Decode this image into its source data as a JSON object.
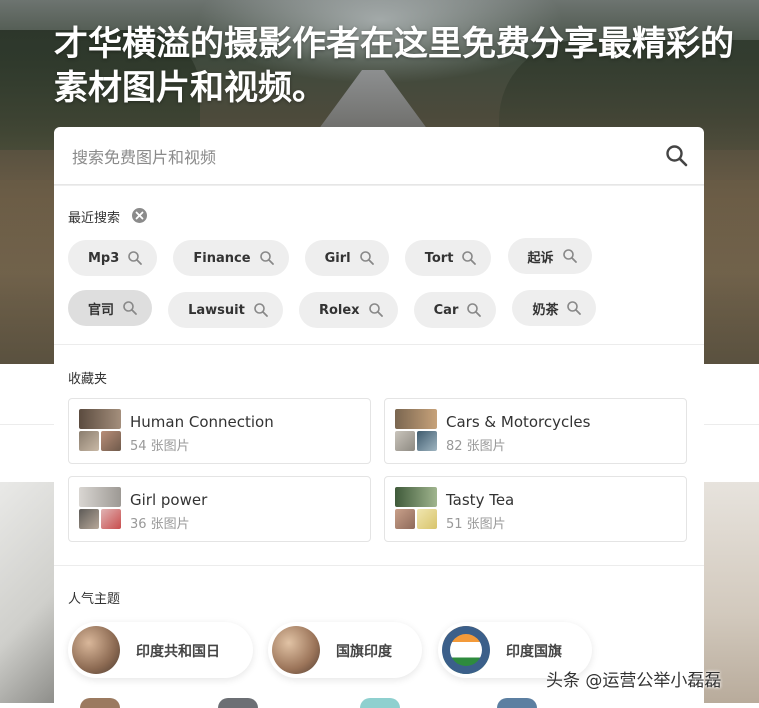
{
  "hero": {
    "headline": "才华横溢的摄影作者在这里免费分享最精彩的素材图片和视频。"
  },
  "search": {
    "placeholder": "搜索免费图片和视频",
    "icon": "search-icon"
  },
  "recent": {
    "title": "最近搜索",
    "items": [
      "Mp3",
      "Finance",
      "Girl",
      "Tort",
      "起诉",
      "官司",
      "Lawsuit",
      "Rolex",
      "Car",
      "奶茶"
    ]
  },
  "collections": {
    "title": "收藏夹",
    "items": [
      {
        "title": "Human Connection",
        "count": "54 张图片"
      },
      {
        "title": "Cars & Motorcycles",
        "count": "82 张图片"
      },
      {
        "title": "Girl power",
        "count": "36 张图片"
      },
      {
        "title": "Tasty Tea",
        "count": "51 张图片"
      }
    ]
  },
  "topics": {
    "title": "人气主题",
    "items": [
      "印度共和国日",
      "国旗印度",
      "印度国旗"
    ]
  },
  "watermark": "头条 @运营公举小磊磊",
  "colors": {
    "chip_bg": "#eeeeee",
    "text": "#333333",
    "muted": "#999999"
  }
}
